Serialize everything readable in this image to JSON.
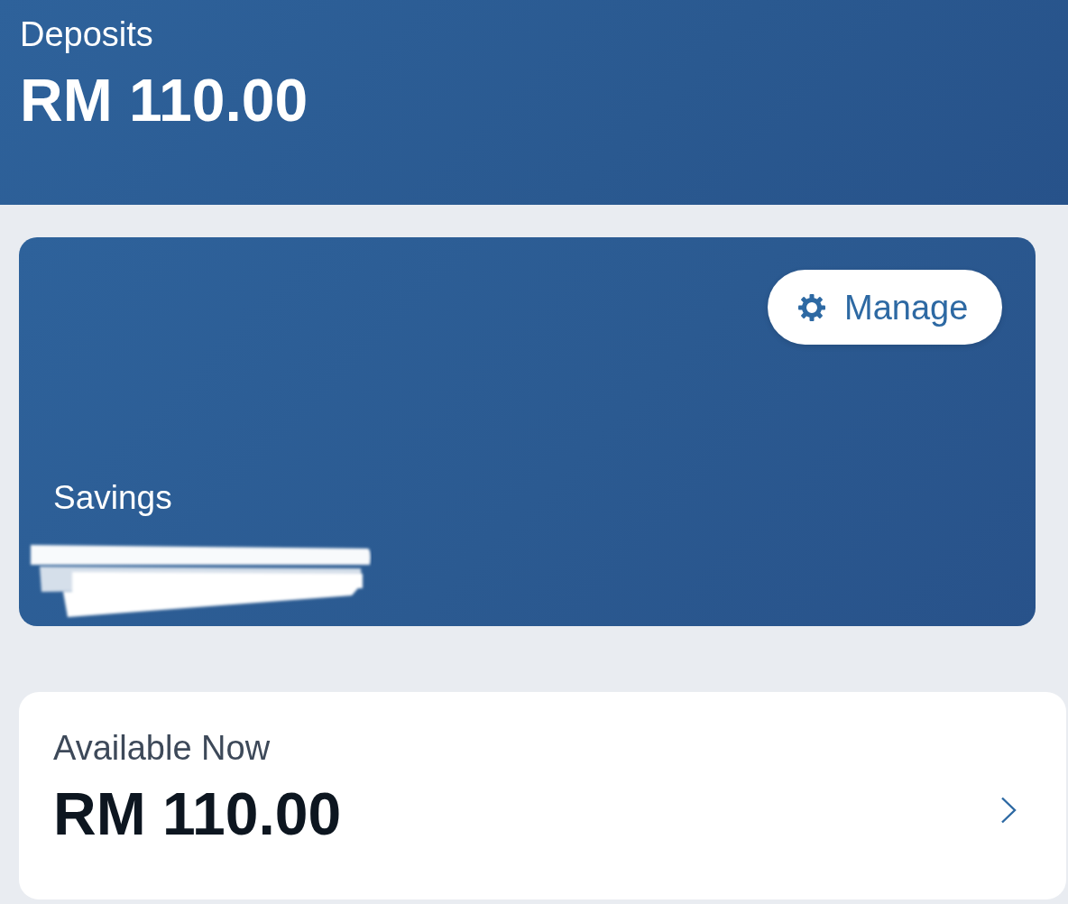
{
  "header": {
    "title": "Deposits",
    "amount": "RM 110.00"
  },
  "account_card": {
    "manage_button": {
      "label": "Manage"
    },
    "account_type": "Savings",
    "account_number_redacted": true
  },
  "balance_card": {
    "label": "Available Now",
    "amount": "RM 110.00"
  }
}
